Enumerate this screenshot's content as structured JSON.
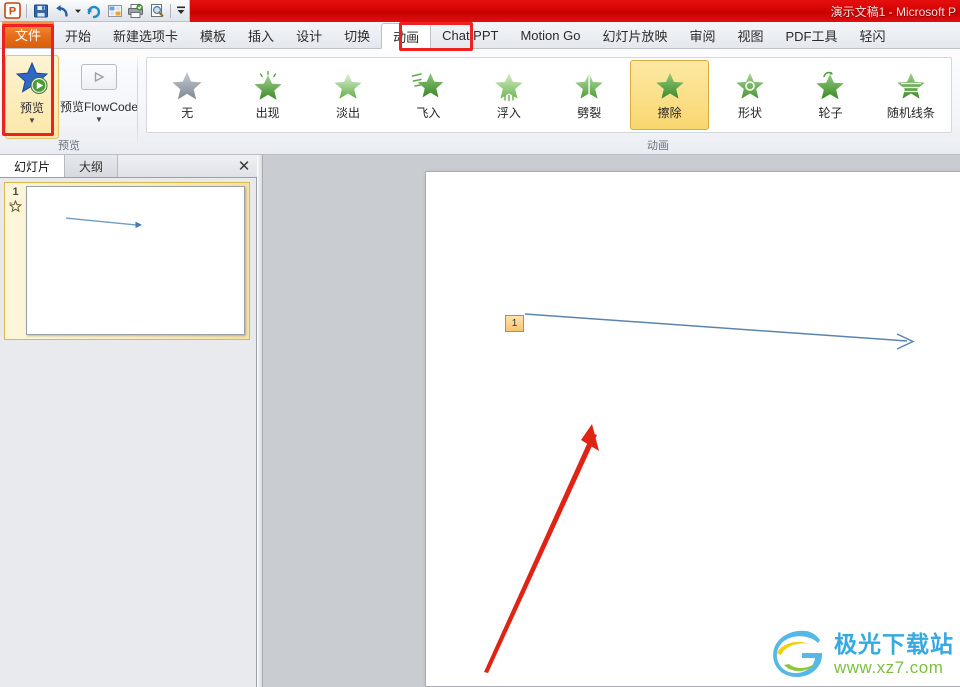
{
  "window": {
    "title": "演示文稿1  -  Microsoft P",
    "accent_red": "#d40404",
    "file_tab_orange": "#e8701a"
  },
  "quick_access": {
    "items": [
      {
        "name": "powerpoint-logo",
        "glyph": "P"
      },
      {
        "name": "save-icon",
        "glyph": "save"
      },
      {
        "name": "undo-icon",
        "glyph": "undo"
      },
      {
        "name": "undo-dropdown-icon",
        "glyph": "caret"
      },
      {
        "name": "redo-icon",
        "glyph": "redo"
      },
      {
        "name": "new-slide-icon",
        "glyph": "layout"
      },
      {
        "name": "print-icon",
        "glyph": "print"
      },
      {
        "name": "print-preview-icon",
        "glyph": "preview"
      },
      {
        "name": "customize-toolbar-icon",
        "glyph": "bar-caret"
      }
    ]
  },
  "tabs": {
    "file_label": "文件",
    "items": [
      {
        "label": "开始",
        "active": false
      },
      {
        "label": "新建选项卡",
        "active": false
      },
      {
        "label": "模板",
        "active": false
      },
      {
        "label": "插入",
        "active": false
      },
      {
        "label": "设计",
        "active": false
      },
      {
        "label": "切换",
        "active": false
      },
      {
        "label": "动画",
        "active": true
      },
      {
        "label": "Chat PPT",
        "active": false
      },
      {
        "label": "Motion Go",
        "active": false
      },
      {
        "label": "幻灯片放映",
        "active": false
      },
      {
        "label": "审阅",
        "active": false
      },
      {
        "label": "视图",
        "active": false
      },
      {
        "label": "PDF工具",
        "active": false
      },
      {
        "label": "轻闪",
        "active": false
      }
    ]
  },
  "ribbon": {
    "preview_group": {
      "label": "预览",
      "preview_button": {
        "label": "预览",
        "icon": "star-play-icon",
        "has_dropdown": true
      },
      "flowcode_button": {
        "label": "预览FlowCode",
        "icon": "play-rect-icon",
        "has_dropdown": true
      }
    },
    "animation_group": {
      "label": "动画",
      "effects": [
        {
          "label": "无",
          "icon": "star-none-icon",
          "selected": false,
          "color": "#9aa3ad"
        },
        {
          "label": "出现",
          "icon": "star-appear-icon",
          "selected": false,
          "color": "#5aa845"
        },
        {
          "label": "淡出",
          "icon": "star-fade-icon",
          "selected": false,
          "color": "#79bf62"
        },
        {
          "label": "飞入",
          "icon": "star-flyin-icon",
          "selected": false,
          "color": "#4f9e3c"
        },
        {
          "label": "浮入",
          "icon": "star-floatin-icon",
          "selected": false,
          "color": "#86c76f"
        },
        {
          "label": "劈裂",
          "icon": "star-split-icon",
          "selected": false,
          "color": "#6bb054"
        },
        {
          "label": "擦除",
          "icon": "star-wipe-icon",
          "selected": true,
          "color": "#4f9e3c"
        },
        {
          "label": "形状",
          "icon": "star-shape-icon",
          "selected": false,
          "color": "#5aa845"
        },
        {
          "label": "轮子",
          "icon": "star-wheel-icon",
          "selected": false,
          "color": "#4f9e3c"
        },
        {
          "label": "随机线条",
          "icon": "star-randomlines-icon",
          "selected": false,
          "color": "#5aa845"
        }
      ]
    }
  },
  "slide_panel": {
    "tabs": [
      {
        "label": "幻灯片",
        "active": true
      },
      {
        "label": "大纲",
        "active": false
      }
    ],
    "close_glyph": "✕",
    "thumbnail": {
      "number": "1",
      "animation_marker": "star-icon"
    }
  },
  "editor": {
    "slide": {
      "animation_tag": "1",
      "shapes": [
        {
          "name": "blue-arrow",
          "color": "#4a7ba7"
        },
        {
          "name": "red-arrow",
          "color": "#e02314"
        }
      ]
    }
  },
  "annotations": [
    {
      "name": "annotation-animation-tab"
    },
    {
      "name": "annotation-preview-button"
    }
  ],
  "watermark": {
    "main": "极光下载站",
    "sub": "www.xz7.com",
    "logo": "aurora-logo-icon"
  }
}
